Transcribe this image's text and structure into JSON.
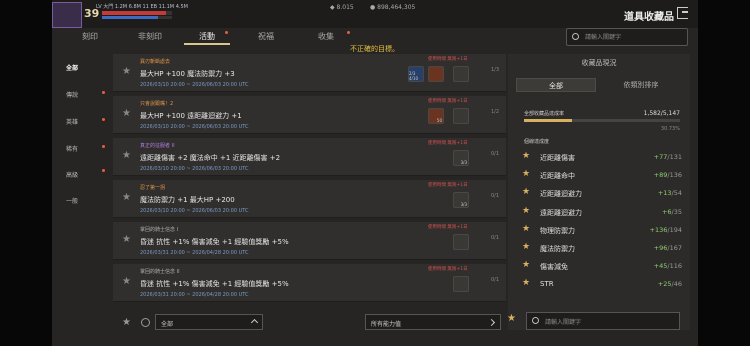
{
  "player": {
    "level": "39",
    "info_line": "LV 大門 1.2M 6.8M 11 EB 11.1M 4.5M"
  },
  "currency": {
    "gem": "8.015",
    "gold": "898,464,305"
  },
  "page_title": "道具收藏品",
  "tabs": [
    {
      "label": "刻印"
    },
    {
      "label": "非刻印"
    },
    {
      "label": "活動"
    },
    {
      "label": "祝福"
    },
    {
      "label": "收集"
    }
  ],
  "warning": "不正確的目標。",
  "search_placeholder": "請輸入關鍵字",
  "categories": [
    {
      "label": "全部"
    },
    {
      "label": "傳說"
    },
    {
      "label": "英雄"
    },
    {
      "label": "稀有"
    },
    {
      "label": "高級"
    },
    {
      "label": "一般"
    }
  ],
  "rows": [
    {
      "tag": "異刃斬斷處去",
      "stat": "最大HP +100 魔法防禦力 +3",
      "date": "2026/03/10 20:00 ~ 2026/06/03 20:00 UTC",
      "note": "使用時間 無限+1日",
      "frac": "1/3",
      "slot_counts": [
        "2/3 4/10",
        "",
        ""
      ]
    },
    {
      "tag": "只會說跟嘴！2",
      "stat": "最大HP +100 遠距離迴避力 +1",
      "date": "2026/03/10 20:00 ~ 2026/06/03 20:00 UTC",
      "note": "使用時間 無限+1日",
      "frac": "1/2",
      "slot_counts": [
        "50",
        ""
      ]
    },
    {
      "tag": "真正的征服者 II",
      "stat": "遠距離傷害 +2 魔法命中 +1 近距離傷害 +2",
      "date": "2026/03/10 20:00 ~ 2026/06/03 20:00 UTC",
      "note": "使用時間 無限+1日",
      "frac": "0/1",
      "slot_counts": [
        "3/3"
      ]
    },
    {
      "tag": "忍了第一拐",
      "stat": "魔法防禦力 +1 最大HP +200",
      "date": "2026/03/10 20:00 ~ 2026/06/03 20:00 UTC",
      "note": "使用時間 無限+1日",
      "frac": "0/1",
      "slot_counts": [
        "3/3"
      ]
    },
    {
      "tag": "掌回的騎士信念 I",
      "stat": "昏迷 抗性 +1% 傷害減免 +1 經驗值獎勵 +5%",
      "date": "2026/03/31 20:00 ~ 2026/04/28 20:00 UTC",
      "note": "使用時間 無限+1日",
      "frac": "0/1",
      "slot_counts": [
        ""
      ]
    },
    {
      "tag": "掌回的騎士信念 II",
      "stat": "昏迷 抗性 +1% 傷害減免 +1 經驗值獎勵 +5%",
      "date": "2026/03/31 20:00 ~ 2026/04/28 20:00 UTC",
      "note": "使用時間 無限+1日",
      "frac": "0/1",
      "slot_counts": [
        ""
      ]
    }
  ],
  "bottom": {
    "filter_all": "全部",
    "filter_stats": "所有能力值"
  },
  "right_panel": {
    "title": "收藏品現況",
    "tab_all": "全部",
    "tab_sort": "依類別排序",
    "progress_label": "全部收藏品達成率",
    "progress_value": "1,582/5,147",
    "progress_fraction": 0.3073,
    "progress_pct": "30.73%",
    "sub_label": "個線達成度",
    "stats": [
      {
        "name": "近距離傷害",
        "gain": "+77",
        "total": "/131"
      },
      {
        "name": "近距離命中",
        "gain": "+89",
        "total": "/136"
      },
      {
        "name": "近距離迴避力",
        "gain": "+13",
        "total": "/54"
      },
      {
        "name": "遠距離迴避力",
        "gain": "+6",
        "total": "/35"
      },
      {
        "name": "物理防禦力",
        "gain": "+136",
        "total": "/194"
      },
      {
        "name": "魔法防禦力",
        "gain": "+96",
        "total": "/167"
      },
      {
        "name": "傷害減免",
        "gain": "+45",
        "total": "/116"
      },
      {
        "name": "STR",
        "gain": "+25",
        "total": "/46"
      }
    ],
    "search_placeholder": "請輸入關鍵字"
  }
}
